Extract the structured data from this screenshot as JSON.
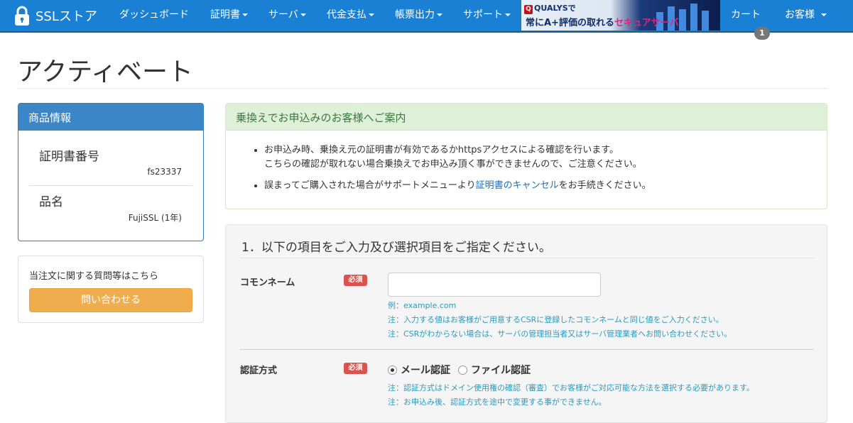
{
  "navbar": {
    "brand": "SSLストア",
    "items": [
      {
        "label": "ダッシュボード",
        "dropdown": false
      },
      {
        "label": "証明書",
        "dropdown": true
      },
      {
        "label": "サーバ",
        "dropdown": true
      },
      {
        "label": "代金支払",
        "dropdown": true
      },
      {
        "label": "帳票出力",
        "dropdown": true
      },
      {
        "label": "サポート",
        "dropdown": true
      }
    ],
    "banner": {
      "line1_brand": "QUALYS",
      "line1_suffix": "で",
      "line2_prefix": "常にA+評価の取れる",
      "line2_highlight": "セキュアサーバ"
    },
    "cart_label": "カート",
    "cart_count": "1",
    "account_label": "お客様"
  },
  "page": {
    "title": "アクティベート"
  },
  "product_panel": {
    "heading": "商品情報",
    "cert_label": "証明書番号",
    "cert_value": "fs23337",
    "name_label": "品名",
    "name_value": "FujiSSL (1年)"
  },
  "contact_panel": {
    "text": "当注文に関する質問等はこちら",
    "button": "問い合わせる"
  },
  "notice": {
    "heading": "乗換えでお申込みのお客様へご案内",
    "item1_line1": "お申込み時、乗換え元の証明書が有効であるかhttpsアクセスによる確認を行います。",
    "item1_line2": "こちらの確認が取れない場合乗換えでお申込み頂く事ができませんので、ご注意ください。",
    "item2_prefix": "誤まってご購入された場合がサポートメニューより",
    "item2_link": "証明書のキャンセル",
    "item2_suffix": "をお手続きください。"
  },
  "form": {
    "title": "1．以下の項目をご入力及び選択項目をご指定ください。",
    "common_name": {
      "label": "コモンネーム",
      "required": "必須",
      "value": "",
      "help1": "例：example.com",
      "help2": "注：入力する値はお客様がご用意するCSRに登録したコモンネームと同じ値をご入力ください。",
      "help3": "注：CSRがわからない場合は、サーバの管理担当者又はサーバ管理業者へお問い合わせください。"
    },
    "auth_method": {
      "label": "認証方式",
      "required": "必須",
      "options": [
        {
          "label": "メール認証",
          "selected": true
        },
        {
          "label": "ファイル認証",
          "selected": false
        }
      ],
      "help1": "注：認証方式はドメイン使用権の確認（審査）でお客様がご対応可能な方法を選択する必要があります。",
      "help2": "注：お申込み後、認証方式を途中で変更する事ができません。"
    }
  },
  "colors": {
    "navbar": "#1a80d4",
    "panel_primary": "#3b86c6",
    "success_bg": "#dff0d8",
    "warning_btn": "#f0ad4e",
    "danger": "#d9534f",
    "help_text": "#2a9bc0"
  }
}
